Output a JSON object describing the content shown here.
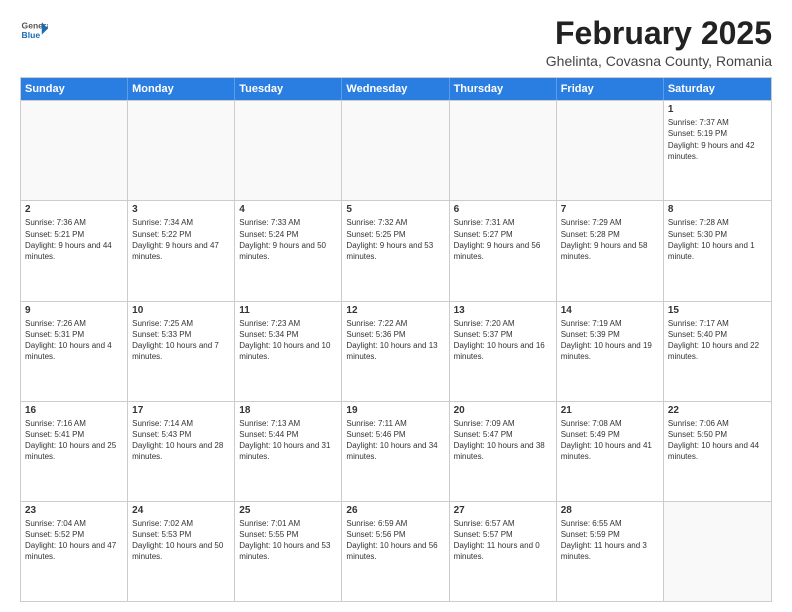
{
  "header": {
    "logo_general": "General",
    "logo_blue": "Blue",
    "month_title": "February 2025",
    "location": "Ghelinta, Covasna County, Romania"
  },
  "weekdays": [
    "Sunday",
    "Monday",
    "Tuesday",
    "Wednesday",
    "Thursday",
    "Friday",
    "Saturday"
  ],
  "rows": [
    [
      {
        "day": "",
        "info": ""
      },
      {
        "day": "",
        "info": ""
      },
      {
        "day": "",
        "info": ""
      },
      {
        "day": "",
        "info": ""
      },
      {
        "day": "",
        "info": ""
      },
      {
        "day": "",
        "info": ""
      },
      {
        "day": "1",
        "info": "Sunrise: 7:37 AM\nSunset: 5:19 PM\nDaylight: 9 hours and 42 minutes."
      }
    ],
    [
      {
        "day": "2",
        "info": "Sunrise: 7:36 AM\nSunset: 5:21 PM\nDaylight: 9 hours and 44 minutes."
      },
      {
        "day": "3",
        "info": "Sunrise: 7:34 AM\nSunset: 5:22 PM\nDaylight: 9 hours and 47 minutes."
      },
      {
        "day": "4",
        "info": "Sunrise: 7:33 AM\nSunset: 5:24 PM\nDaylight: 9 hours and 50 minutes."
      },
      {
        "day": "5",
        "info": "Sunrise: 7:32 AM\nSunset: 5:25 PM\nDaylight: 9 hours and 53 minutes."
      },
      {
        "day": "6",
        "info": "Sunrise: 7:31 AM\nSunset: 5:27 PM\nDaylight: 9 hours and 56 minutes."
      },
      {
        "day": "7",
        "info": "Sunrise: 7:29 AM\nSunset: 5:28 PM\nDaylight: 9 hours and 58 minutes."
      },
      {
        "day": "8",
        "info": "Sunrise: 7:28 AM\nSunset: 5:30 PM\nDaylight: 10 hours and 1 minute."
      }
    ],
    [
      {
        "day": "9",
        "info": "Sunrise: 7:26 AM\nSunset: 5:31 PM\nDaylight: 10 hours and 4 minutes."
      },
      {
        "day": "10",
        "info": "Sunrise: 7:25 AM\nSunset: 5:33 PM\nDaylight: 10 hours and 7 minutes."
      },
      {
        "day": "11",
        "info": "Sunrise: 7:23 AM\nSunset: 5:34 PM\nDaylight: 10 hours and 10 minutes."
      },
      {
        "day": "12",
        "info": "Sunrise: 7:22 AM\nSunset: 5:36 PM\nDaylight: 10 hours and 13 minutes."
      },
      {
        "day": "13",
        "info": "Sunrise: 7:20 AM\nSunset: 5:37 PM\nDaylight: 10 hours and 16 minutes."
      },
      {
        "day": "14",
        "info": "Sunrise: 7:19 AM\nSunset: 5:39 PM\nDaylight: 10 hours and 19 minutes."
      },
      {
        "day": "15",
        "info": "Sunrise: 7:17 AM\nSunset: 5:40 PM\nDaylight: 10 hours and 22 minutes."
      }
    ],
    [
      {
        "day": "16",
        "info": "Sunrise: 7:16 AM\nSunset: 5:41 PM\nDaylight: 10 hours and 25 minutes."
      },
      {
        "day": "17",
        "info": "Sunrise: 7:14 AM\nSunset: 5:43 PM\nDaylight: 10 hours and 28 minutes."
      },
      {
        "day": "18",
        "info": "Sunrise: 7:13 AM\nSunset: 5:44 PM\nDaylight: 10 hours and 31 minutes."
      },
      {
        "day": "19",
        "info": "Sunrise: 7:11 AM\nSunset: 5:46 PM\nDaylight: 10 hours and 34 minutes."
      },
      {
        "day": "20",
        "info": "Sunrise: 7:09 AM\nSunset: 5:47 PM\nDaylight: 10 hours and 38 minutes."
      },
      {
        "day": "21",
        "info": "Sunrise: 7:08 AM\nSunset: 5:49 PM\nDaylight: 10 hours and 41 minutes."
      },
      {
        "day": "22",
        "info": "Sunrise: 7:06 AM\nSunset: 5:50 PM\nDaylight: 10 hours and 44 minutes."
      }
    ],
    [
      {
        "day": "23",
        "info": "Sunrise: 7:04 AM\nSunset: 5:52 PM\nDaylight: 10 hours and 47 minutes."
      },
      {
        "day": "24",
        "info": "Sunrise: 7:02 AM\nSunset: 5:53 PM\nDaylight: 10 hours and 50 minutes."
      },
      {
        "day": "25",
        "info": "Sunrise: 7:01 AM\nSunset: 5:55 PM\nDaylight: 10 hours and 53 minutes."
      },
      {
        "day": "26",
        "info": "Sunrise: 6:59 AM\nSunset: 5:56 PM\nDaylight: 10 hours and 56 minutes."
      },
      {
        "day": "27",
        "info": "Sunrise: 6:57 AM\nSunset: 5:57 PM\nDaylight: 11 hours and 0 minutes."
      },
      {
        "day": "28",
        "info": "Sunrise: 6:55 AM\nSunset: 5:59 PM\nDaylight: 11 hours and 3 minutes."
      },
      {
        "day": "",
        "info": ""
      }
    ]
  ]
}
